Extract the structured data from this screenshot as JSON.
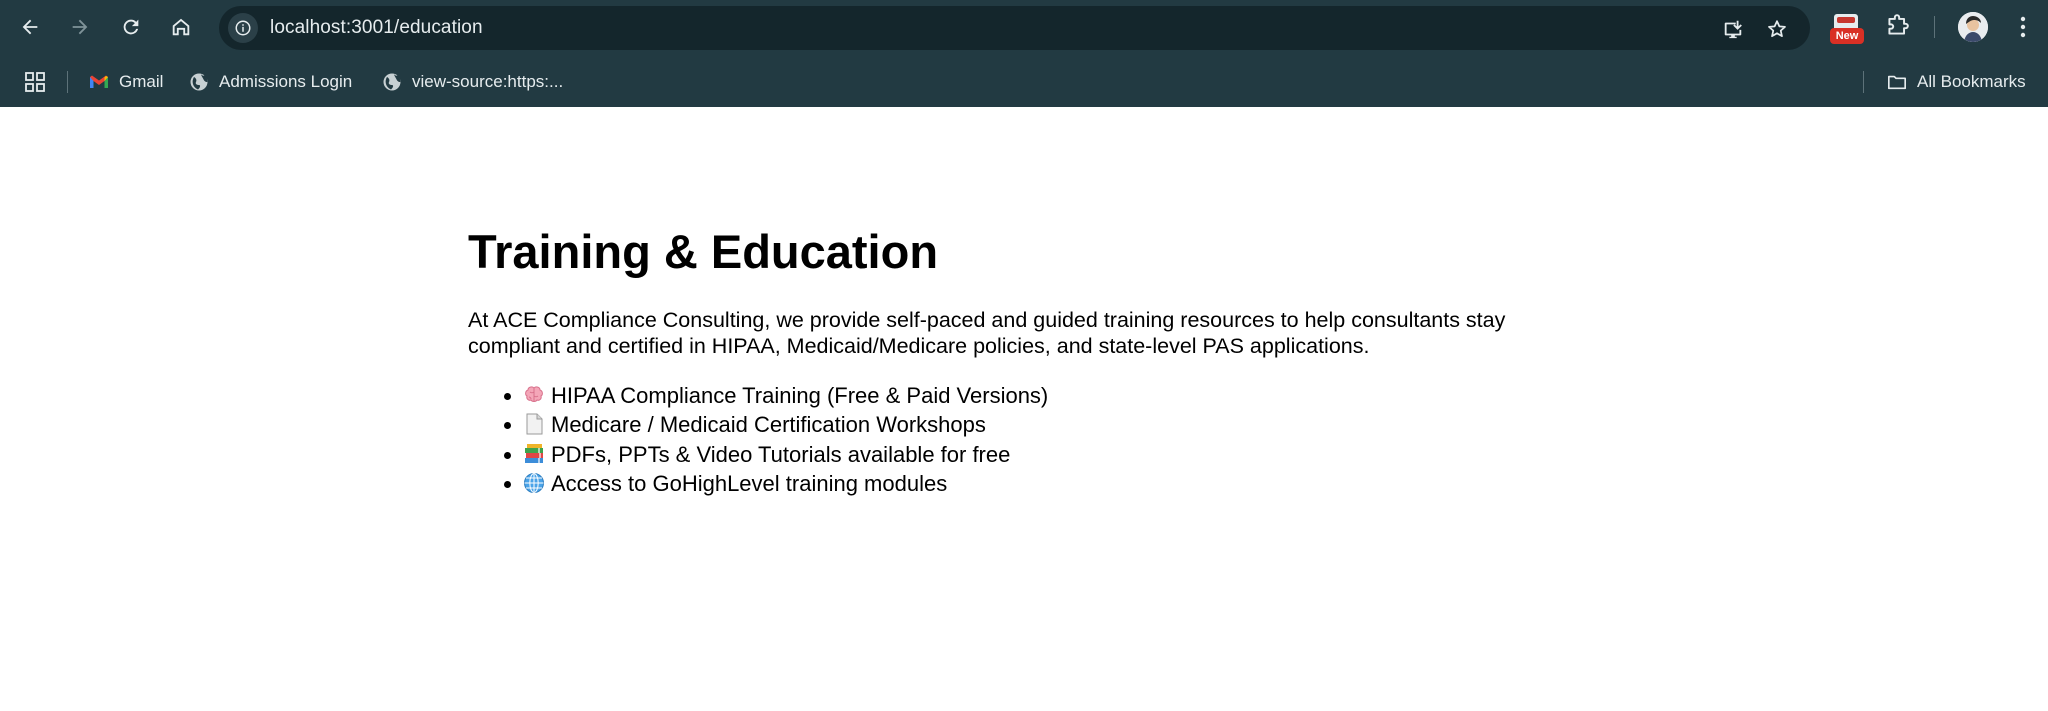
{
  "browser": {
    "url": "localhost:3001/education",
    "extension_badge": "New",
    "bookmarks": [
      {
        "label": "Gmail",
        "icon": "gmail-icon"
      },
      {
        "label": "Admissions Login",
        "icon": "globe-icon"
      },
      {
        "label": "view-source:https:...",
        "icon": "globe-icon"
      }
    ],
    "all_bookmarks_label": "All Bookmarks"
  },
  "page": {
    "title": "Training & Education",
    "intro": "At ACE Compliance Consulting, we provide self-paced and guided training resources to help consultants stay compliant and certified in HIPAA, Medicaid/Medicare policies, and state-level PAS applications.",
    "features": [
      {
        "icon": "brain-icon",
        "label": "HIPAA Compliance Training (Free & Paid Versions)"
      },
      {
        "icon": "document-icon",
        "label": "Medicare / Medicaid Certification Workshops"
      },
      {
        "icon": "books-icon",
        "label": "PDFs, PPTs & Video Tutorials available for free"
      },
      {
        "icon": "globe-icon",
        "label": "Access to GoHighLevel training modules"
      }
    ]
  },
  "colors": {
    "chrome_bg": "#223a42",
    "omnibox_bg": "#14262c",
    "chrome_text": "#e6ecee",
    "badge_red": "#d93025",
    "page_bg": "#ffffff",
    "text": "#000000"
  }
}
